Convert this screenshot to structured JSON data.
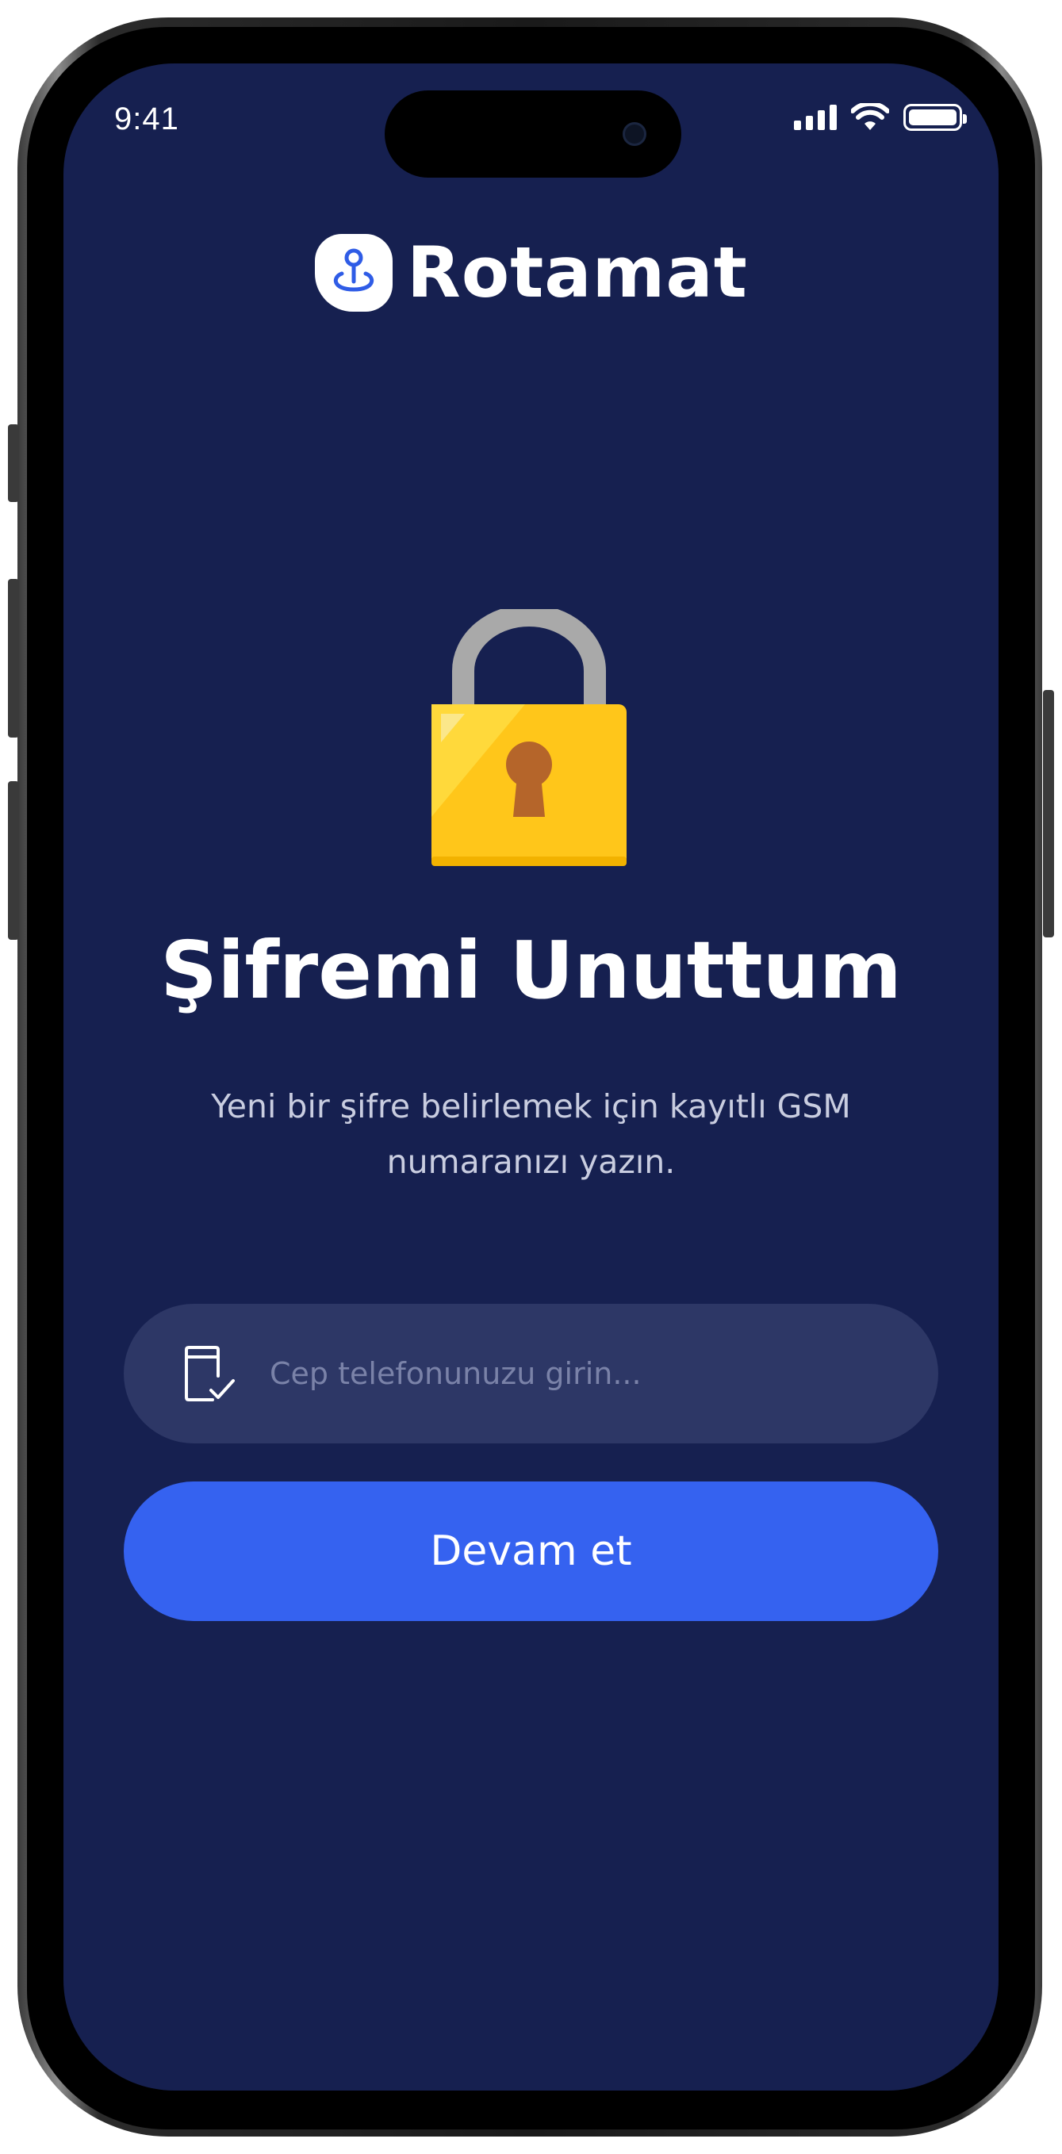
{
  "status_bar": {
    "time": "9:41"
  },
  "brand": {
    "name": "Rotamat"
  },
  "page": {
    "title": "Şifremi Unuttum",
    "subtitle": "Yeni bir şifre belirlemek için kayıtlı GSM numaranızı yazın."
  },
  "form": {
    "phone_placeholder": "Cep telefonunuzu girin...",
    "phone_value": "",
    "submit_label": "Devam et"
  },
  "colors": {
    "background": "#162050",
    "input_background": "#2d3766",
    "button": "#3562f0",
    "lock_body": "#ffc61a",
    "lock_shackle": "#a8a8a8"
  },
  "icons": {
    "logo": "location-pin-icon",
    "hero": "padlock-icon",
    "input": "phone-check-icon"
  }
}
